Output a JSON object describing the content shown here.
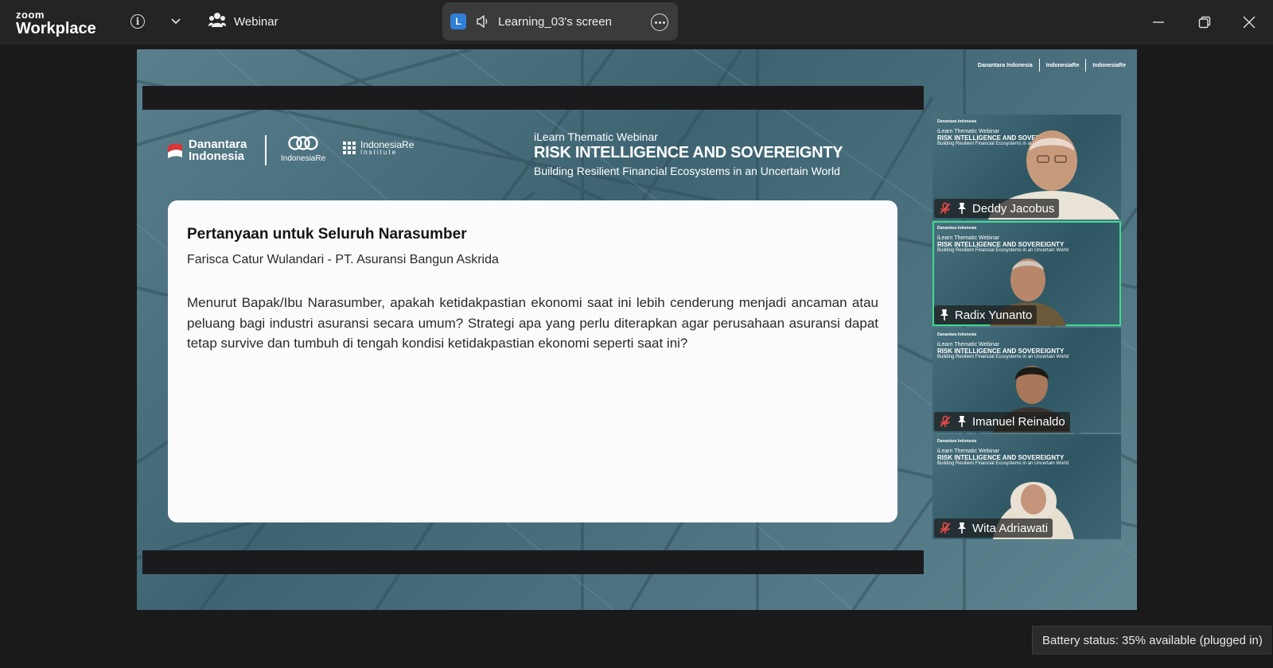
{
  "titlebar": {
    "logo_small": "zoom",
    "logo_big": "Workplace",
    "webinar_label": "Webinar",
    "screen_share": {
      "avatar_letter": "L",
      "label": "Learning_03's screen"
    }
  },
  "icons": {
    "info": "info-icon",
    "chevron": "chevron-down-icon",
    "participants": "participants-icon",
    "speaker": "speaker-icon",
    "more": "more-options-icon",
    "minimize": "minimize-icon",
    "restore": "restore-icon",
    "close": "close-icon",
    "mic_muted": "mic-muted-icon",
    "pin": "pin-icon"
  },
  "slide": {
    "logo_danantara": "Danantara Indonesia",
    "logo_indonesiare": "IndonesiaRe",
    "logo_institute_1": "IndonesiaRe",
    "logo_institute_2": "Institute",
    "eyebrow": "iLearn Thematic Webinar",
    "title": "RISK INTELLIGENCE AND SOVEREIGNTY",
    "subtitle": "Building Resilient Financial Ecosystems in an Uncertain World",
    "question": {
      "heading": "Pertanyaan untuk Seluruh Narasumber",
      "author": "Farisca Catur Wulandari - PT. Asuransi Bangun Askrida",
      "body": "Menurut Bapak/Ibu Narasumber, apakah ketidakpastian ekonomi saat ini lebih cenderung menjadi ancaman atau peluang bagi industri asuransi secara umum? Strategi apa yang perlu diterapkan agar perusahaan asuransi dapat tetap survive dan tumbuh di tengah kondisi ketidakpastian ekonomi seperti saat ini?"
    }
  },
  "participants": [
    {
      "name": "Deddy Jacobus",
      "muted": true,
      "active": false
    },
    {
      "name": "Radix Yunanto",
      "muted": false,
      "active": true
    },
    {
      "name": "Imanuel Reinaldo",
      "muted": true,
      "active": false
    },
    {
      "name": "Wita Adriawati",
      "muted": true,
      "active": false
    }
  ],
  "tooltip": {
    "battery": "Battery status: 35% available (plugged in)"
  },
  "colors": {
    "titlebar": "#242424",
    "active_speaker": "#3ddb8e",
    "slide_teal": "#4a6f7d",
    "danantara_red": "#d8353b"
  }
}
